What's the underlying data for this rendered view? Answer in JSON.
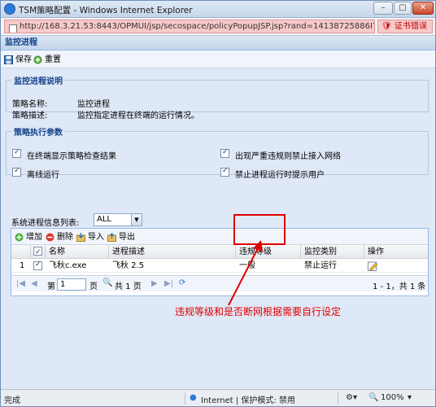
{
  "window": {
    "title": "TSM策略配置 - Windows Internet Explorer",
    "min": "–",
    "max": "▢",
    "close": "✕"
  },
  "address": {
    "url": "http://168.3.21.53:8443/OPMUI/jsp/secospace/policyPopupJSP.jsp?rand=14138725886I7",
    "cert_label": "证书错误",
    "cert_x": "✕"
  },
  "panel": {
    "title": "监控进程"
  },
  "toolbar": {
    "save": "保存",
    "reset": "重置"
  },
  "desc": {
    "legend": "监控进程说明",
    "name_label": "策略名称:",
    "name_value": "监控进程",
    "desc_label": "策略描述:",
    "desc_value": "监控指定进程在终端的运行情况。"
  },
  "params": {
    "legend": "策略执行参数",
    "opt1": "在终端显示策略检查结果",
    "opt2": "离线运行",
    "opt3": "出现严重违规则禁止接入网络",
    "opt4": "禁止进程运行时提示用户",
    "list_label": "系统进程信息列表:",
    "list_value": "ALL"
  },
  "grid": {
    "add": "增加",
    "del": "删除",
    "import": "导入",
    "export": "导出",
    "cols": [
      "名称",
      "进程描述",
      "违规等级",
      "监控类别",
      "操作"
    ],
    "rows": [
      {
        "num": "1",
        "name": "飞秋c.exe",
        "desc": "飞秋 2.5",
        "level": "一般",
        "cat": "禁止运行"
      }
    ],
    "pager": {
      "page_prefix": "第",
      "page": "1",
      "page_suffix": "页",
      "total": "共 1 页",
      "range": "1 - 1，共 1 条"
    }
  },
  "annotation": "违规等级和是否断网根据需要自行设定",
  "status": {
    "done": "完成",
    "zone": "Internet | 保护模式: 禁用",
    "zoom": "100%"
  },
  "colors": {
    "annotation": "#e00000",
    "header": "#15428b"
  }
}
